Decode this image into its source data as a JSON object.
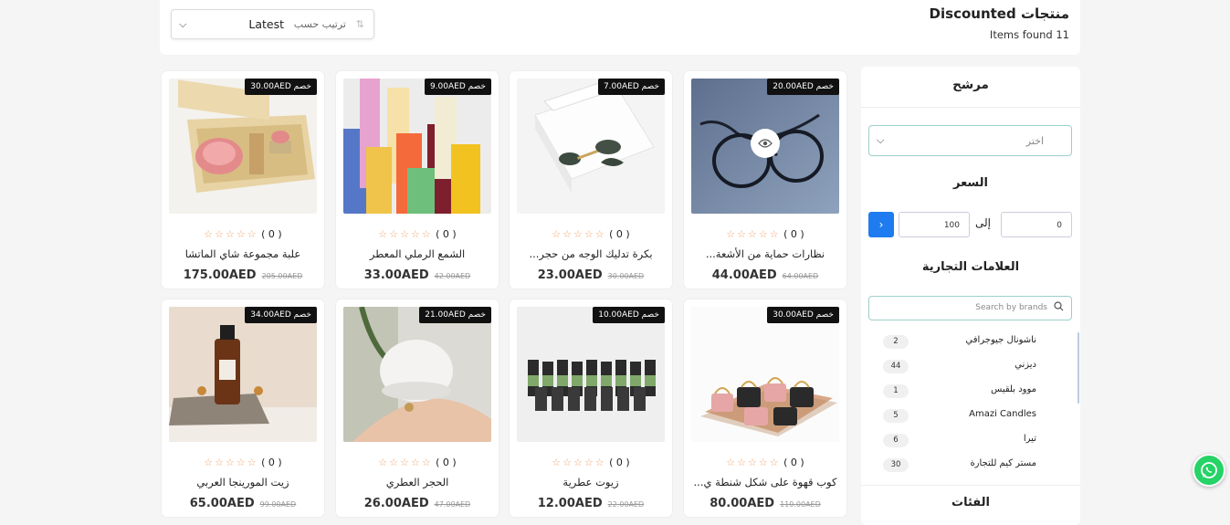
{
  "header": {
    "title": "Discounted منتجات",
    "items_found": "Items found 11",
    "sort": {
      "label": "ترتيب حسب",
      "value": "Latest"
    }
  },
  "sidebar": {
    "title": "مرشح",
    "select_placeholder": "اختر",
    "price": {
      "title": "السعر",
      "min": "0",
      "to": "إلى",
      "max": "100"
    },
    "brands": {
      "title": "العلامات التجارية",
      "search_placeholder": "Search by brands",
      "items": [
        {
          "label": "ناشونال جيوجرافي",
          "count": "2"
        },
        {
          "label": "ديزني",
          "count": "44"
        },
        {
          "label": "موود بلقيس",
          "count": "1"
        },
        {
          "label": "Amazi Candles",
          "count": "5"
        },
        {
          "label": "تيرا",
          "count": "6"
        },
        {
          "label": "مستر كيم للتجارة",
          "count": "30"
        }
      ]
    },
    "categories_title": "الفئات"
  },
  "products": [
    {
      "name": "علبة مجموعة شاي الماتشا",
      "price": "175.00AED",
      "old_price": "205.00AED",
      "discount": "30.00AED خصم",
      "rating": "( 0 )",
      "stars": "☆☆☆☆☆",
      "image": "matcha-box"
    },
    {
      "name": "الشمع الرملي المعطر",
      "price": "33.00AED",
      "old_price": "42.00AED",
      "discount": "9.00AED خصم",
      "rating": "( 0 )",
      "stars": "☆☆☆☆☆",
      "image": "sand-candles"
    },
    {
      "name": "بكرة تدليك الوجه من حجر...",
      "price": "23.00AED",
      "old_price": "30.00AED",
      "discount": "7.00AED خصم",
      "rating": "( 0 )",
      "stars": "☆☆☆☆☆",
      "image": "face-roller"
    },
    {
      "name": "نظارات حماية من الأشعة...",
      "price": "44.00AED",
      "old_price": "64.00AED",
      "discount": "20.00AED خصم",
      "rating": "( 0 )",
      "stars": "☆☆☆☆☆",
      "image": "glasses"
    },
    {
      "name": "زيت المورينجا العربي",
      "price": "65.00AED",
      "old_price": "99.00AED",
      "discount": "34.00AED خصم",
      "rating": "( 0 )",
      "stars": "☆☆☆☆☆",
      "image": "moringa-oil"
    },
    {
      "name": "الحجر العطري",
      "price": "26.00AED",
      "old_price": "47.00AED",
      "discount": "21.00AED خصم",
      "rating": "( 0 )",
      "stars": "☆☆☆☆☆",
      "image": "aroma-stone"
    },
    {
      "name": "زيوت عطرية",
      "price": "12.00AED",
      "old_price": "22.00AED",
      "discount": "10.00AED خصم",
      "rating": "( 0 )",
      "stars": "☆☆☆☆☆",
      "image": "essential-oils"
    },
    {
      "name": "كوب قهوة على شكل شنطة ي...",
      "price": "80.00AED",
      "old_price": "110.00AED",
      "discount": "30.00AED خصم",
      "rating": "( 0 )",
      "stars": "☆☆☆☆☆",
      "image": "bag-cups"
    }
  ]
}
